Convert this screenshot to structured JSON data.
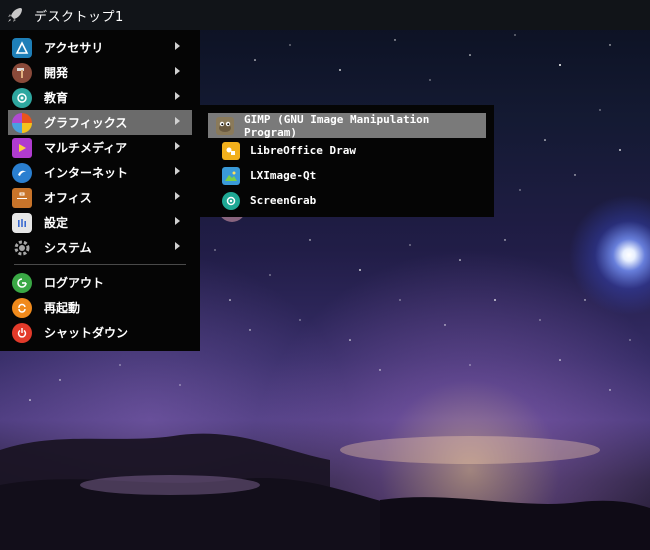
{
  "taskbar": {
    "desktop_label": "デスクトップ1"
  },
  "menu": {
    "items": [
      {
        "label": "アクセサリ",
        "icon": "accessories-icon",
        "color": "#1e7fb8",
        "submenu": true
      },
      {
        "label": "開発",
        "icon": "hammer-icon",
        "color": "#8a4a3a",
        "submenu": true
      },
      {
        "label": "教育",
        "icon": "education-icon",
        "color": "#2ea7a0",
        "submenu": true
      },
      {
        "label": "グラフィックス",
        "icon": "graphics-icon",
        "color": "#e9541c",
        "submenu": true,
        "active": true
      },
      {
        "label": "マルチメディア",
        "icon": "multimedia-icon",
        "color": "#b03bd0",
        "submenu": true
      },
      {
        "label": "インターネット",
        "icon": "internet-icon",
        "color": "#2a7fd0",
        "submenu": true
      },
      {
        "label": "オフィス",
        "icon": "briefcase-icon",
        "color": "#c8742a",
        "submenu": true
      },
      {
        "label": "設定",
        "icon": "settings-icon",
        "color": "#d9d9d9",
        "submenu": true
      },
      {
        "label": "システム",
        "icon": "gear-icon",
        "color": "#9a9a9a",
        "submenu": true
      }
    ],
    "session": [
      {
        "label": "ログアウト",
        "icon": "logout-icon",
        "color": "#3aa845"
      },
      {
        "label": "再起動",
        "icon": "restart-icon",
        "color": "#f08a1c"
      },
      {
        "label": "シャットダウン",
        "icon": "power-icon",
        "color": "#e23a2a"
      }
    ]
  },
  "submenu": {
    "items": [
      {
        "label": "GIMP (GNU Image Manipulation Program)",
        "icon": "gimp-icon",
        "active": true
      },
      {
        "label": "LibreOffice Draw",
        "icon": "libreoffice-draw-icon"
      },
      {
        "label": "LXImage-Qt",
        "icon": "image-viewer-icon"
      },
      {
        "label": "ScreenGrab",
        "icon": "screengrab-icon"
      }
    ]
  }
}
